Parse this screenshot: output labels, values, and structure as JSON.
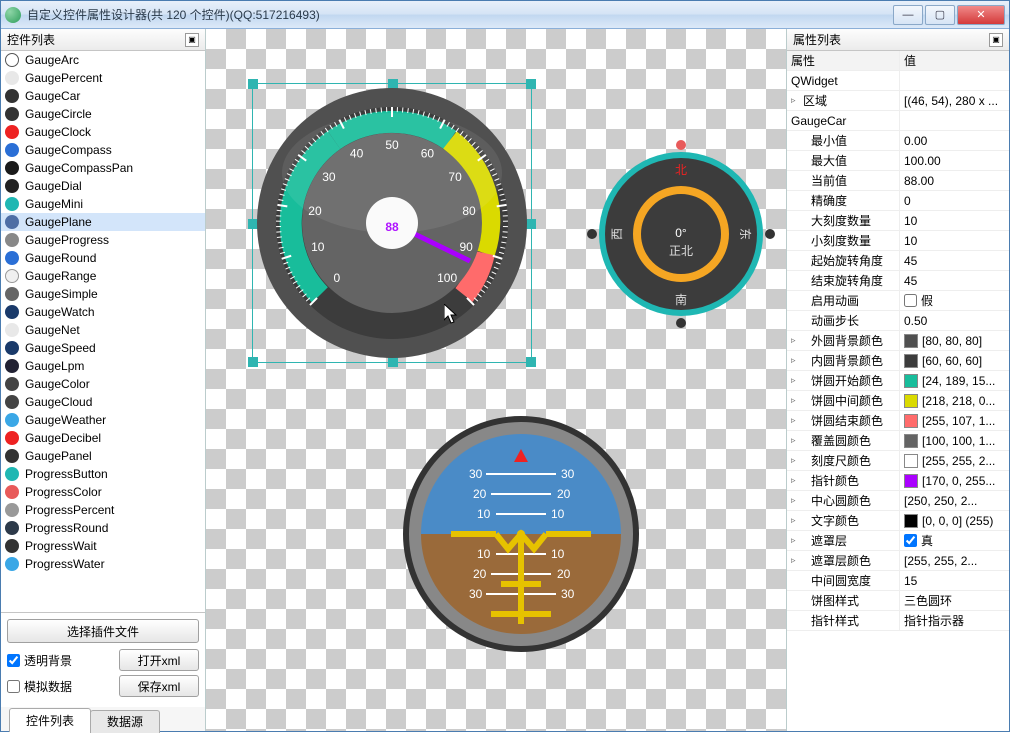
{
  "titlebar": {
    "title": "自定义控件属性设计器(共 120 个控件)(QQ:517216493)"
  },
  "left": {
    "header": "控件列表",
    "items": [
      {
        "name": "GaugeArc",
        "color": "#fff",
        "border": "#555"
      },
      {
        "name": "GaugePercent",
        "color": "#e8e8e8"
      },
      {
        "name": "GaugeCar",
        "color": "#333"
      },
      {
        "name": "GaugeCircle",
        "color": "#333"
      },
      {
        "name": "GaugeClock",
        "color": "#e22"
      },
      {
        "name": "GaugeCompass",
        "color": "#2a6fd6"
      },
      {
        "name": "GaugeCompassPan",
        "color": "#1a1a1a"
      },
      {
        "name": "GaugeDial",
        "color": "#222"
      },
      {
        "name": "GaugeMini",
        "color": "#1fb7b3"
      },
      {
        "name": "GaugePlane",
        "color": "#4e6ea5",
        "sel": true
      },
      {
        "name": "GaugeProgress",
        "color": "#888"
      },
      {
        "name": "GaugeRound",
        "color": "#2a6fd6"
      },
      {
        "name": "GaugeRange",
        "color": "#f0f0f0",
        "border": "#999"
      },
      {
        "name": "GaugeSimple",
        "color": "#666"
      },
      {
        "name": "GaugeWatch",
        "color": "#1a3a6a"
      },
      {
        "name": "GaugeNet",
        "color": "#e8e8e8"
      },
      {
        "name": "GaugeSpeed",
        "color": "#1a3a6a"
      },
      {
        "name": "GaugeLpm",
        "color": "#223"
      },
      {
        "name": "GaugeColor",
        "color": "#444"
      },
      {
        "name": "GaugeCloud",
        "color": "#444"
      },
      {
        "name": "GaugeWeather",
        "color": "#3aa7e6"
      },
      {
        "name": "GaugeDecibel",
        "color": "#e22"
      },
      {
        "name": "GaugePanel",
        "color": "#333"
      },
      {
        "name": "ProgressButton",
        "color": "#1fb7b3"
      },
      {
        "name": "ProgressColor",
        "color": "#e85a5a"
      },
      {
        "name": "ProgressPercent",
        "color": "#999"
      },
      {
        "name": "ProgressRound",
        "color": "#2d3a4a"
      },
      {
        "name": "ProgressWait",
        "color": "#333"
      },
      {
        "name": "ProgressWater",
        "color": "#3aa7e6"
      }
    ],
    "select_plugin_file": "选择插件文件",
    "transparent_bg": "透明背景",
    "mock_data": "模拟数据",
    "open_xml": "打开xml",
    "save_xml": "保存xml",
    "tab_list": "控件列表",
    "tab_datasource": "数据源"
  },
  "gauge_car": {
    "value_label": "88",
    "ticks": [
      "0",
      "10",
      "20",
      "30",
      "40",
      "50",
      "60",
      "70",
      "80",
      "90",
      "100"
    ]
  },
  "compass": {
    "angle": "0°",
    "sub": "正北",
    "n": "北",
    "s": "南",
    "e": "东",
    "w": "西"
  },
  "plane": {
    "ticks_left": [
      "30",
      "20",
      "10"
    ],
    "ticks_right": [
      "30",
      "20",
      "10"
    ],
    "ticks_bl": [
      "10",
      "20",
      "30"
    ],
    "ticks_br": [
      "10",
      "20",
      "30"
    ]
  },
  "right": {
    "header": "属性列表",
    "col_prop": "属性",
    "col_val": "值",
    "section1": "QWidget",
    "area_label": "区域",
    "area_val": "[(46, 54), 280 x ...",
    "section2": "GaugeCar",
    "rows": [
      {
        "n": "最小值",
        "v": "0.00"
      },
      {
        "n": "最大值",
        "v": "100.00"
      },
      {
        "n": "当前值",
        "v": "88.00"
      },
      {
        "n": "精确度",
        "v": "0"
      },
      {
        "n": "大刻度数量",
        "v": "10"
      },
      {
        "n": "小刻度数量",
        "v": "10"
      },
      {
        "n": "起始旋转角度",
        "v": "45"
      },
      {
        "n": "结束旋转角度",
        "v": "45"
      },
      {
        "n": "启用动画",
        "v": "假",
        "chk": false
      },
      {
        "n": "动画步长",
        "v": "0.50"
      },
      {
        "n": "外圆背景颜色",
        "v": "[80, 80, 80]",
        "c": "#505050",
        "tw": true
      },
      {
        "n": "内圆背景颜色",
        "v": "[60, 60, 60]",
        "c": "#3c3c3c",
        "tw": true
      },
      {
        "n": "饼圆开始颜色",
        "v": "[24, 189, 15...",
        "c": "#18bd9b",
        "tw": true
      },
      {
        "n": "饼圆中间颜色",
        "v": "[218, 218, 0...",
        "c": "#dada00",
        "tw": true
      },
      {
        "n": "饼圆结束颜色",
        "v": "[255, 107, 1...",
        "c": "#ff6b6b",
        "tw": true
      },
      {
        "n": "覆盖圆颜色",
        "v": "[100, 100, 1...",
        "c": "#646464",
        "tw": true
      },
      {
        "n": "刻度尺颜色",
        "v": "[255, 255, 2...",
        "c": "#ffffff",
        "tw": true
      },
      {
        "n": "指针颜色",
        "v": "[170, 0, 255...",
        "c": "#aa00ff",
        "tw": true
      },
      {
        "n": "中心圆颜色",
        "v": "[250, 250, 2...",
        "tw": true
      },
      {
        "n": "文字颜色",
        "v": "[0, 0, 0] (255)",
        "c": "#000000",
        "tw": true
      },
      {
        "n": "遮罩层",
        "v": "真",
        "chk": true,
        "tw": true
      },
      {
        "n": "遮罩层颜色",
        "v": "[255, 255, 2...",
        "tw": true
      },
      {
        "n": "中间圆宽度",
        "v": "15"
      },
      {
        "n": "饼图样式",
        "v": "三色圆环"
      },
      {
        "n": "指针样式",
        "v": "指针指示器"
      }
    ]
  }
}
